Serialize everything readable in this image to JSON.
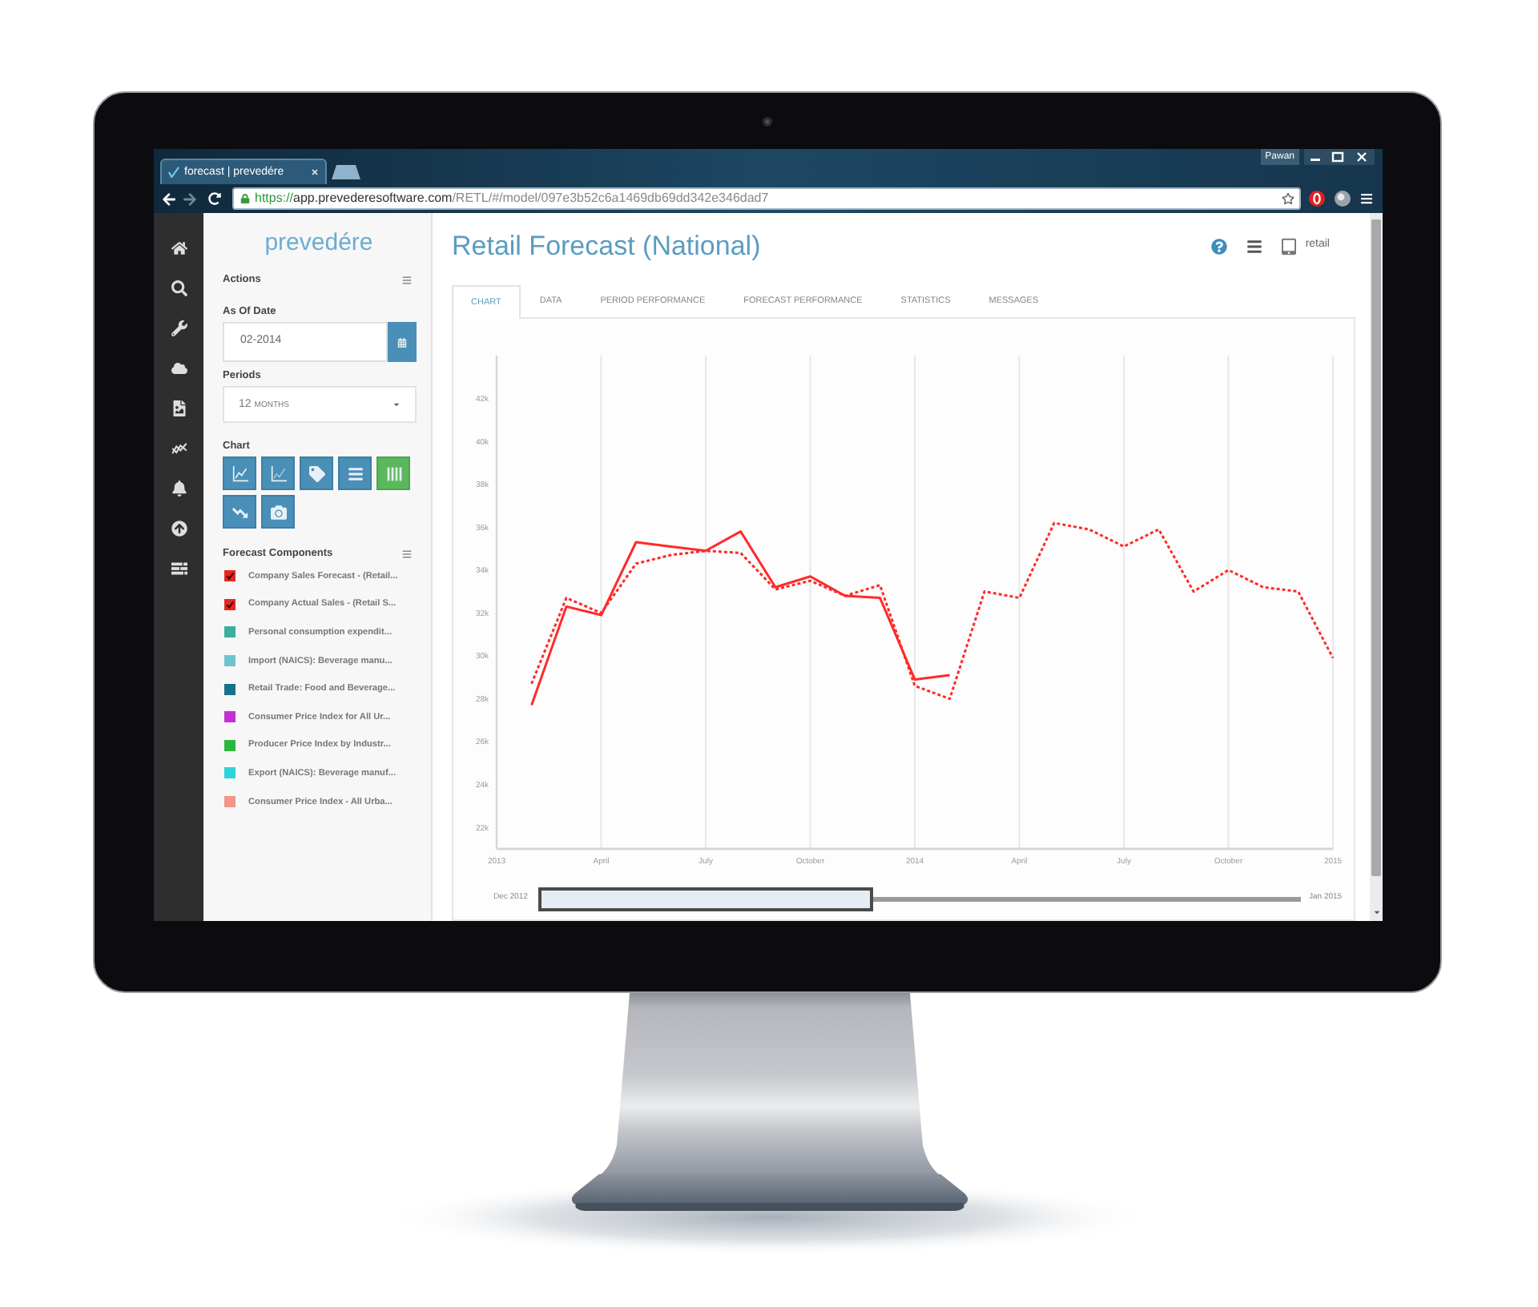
{
  "browser": {
    "tab": {
      "title": "forecast | prevedére"
    },
    "profile": "Pawan",
    "toolbar": {
      "back": {
        "disabled": false
      },
      "forward": {
        "disabled": true
      }
    },
    "address": {
      "scheme": "https://",
      "host": "app.prevederesoftware.com",
      "path": "/RETL/#/model/097e3b52c6a1469db69dd342e346dad7"
    }
  },
  "sidebar": {
    "logo": "prevedére",
    "actions": {
      "label": "Actions"
    },
    "as_of_date": {
      "label": "As Of Date",
      "value": "02-2014"
    },
    "periods": {
      "label": "Periods",
      "value": "12",
      "unit": "MONTHS"
    },
    "chart": {
      "label": "Chart",
      "buttons": [
        {
          "selected": false
        },
        {
          "selected": false
        },
        {
          "selected": false
        },
        {
          "selected": false
        },
        {
          "selected": true
        },
        {
          "selected": false
        },
        {
          "selected": false
        }
      ]
    },
    "components": {
      "label": "Forecast Components",
      "items": [
        {
          "label": "Company Sales Forecast - (Retail...",
          "color": "#e8251f",
          "checked": true
        },
        {
          "label": "Company Actual Sales - (Retail S...",
          "color": "#e8251f",
          "checked": true
        },
        {
          "label": "Personal consumption expendit...",
          "color": "#3bae9f",
          "checked": false
        },
        {
          "label": "Import (NAICS): Beverage manu...",
          "color": "#6cc6cb",
          "checked": false
        },
        {
          "label": "Retail Trade: Food and Beverage...",
          "color": "#16728a",
          "checked": false
        },
        {
          "label": "Consumer Price Index for All Ur...",
          "color": "#c42fd3",
          "checked": false
        },
        {
          "label": "Producer Price Index by Industr...",
          "color": "#2bb63e",
          "checked": false
        },
        {
          "label": "Export (NAICS): Beverage manuf...",
          "color": "#2ad4d8",
          "checked": false
        },
        {
          "label": "Consumer Price Index - All Urba...",
          "color": "#f3958a",
          "checked": false
        }
      ]
    }
  },
  "main": {
    "title": "Retail Forecast (National)",
    "account": "retail",
    "tabs": [
      {
        "label": "CHART",
        "selected": true
      },
      {
        "label": "DATA",
        "selected": false
      },
      {
        "label": "PERIOD PERFORMANCE",
        "selected": false
      },
      {
        "label": "FORECAST PERFORMANCE",
        "selected": false
      },
      {
        "label": "STATISTICS",
        "selected": false
      },
      {
        "label": "MESSAGES",
        "selected": false
      }
    ],
    "chart": {
      "chart_data": {
        "type": "line",
        "grid": true,
        "categories": [
          "2013",
          null,
          null,
          "April",
          null,
          null,
          "July",
          null,
          null,
          "October",
          null,
          null,
          "2014",
          null,
          null,
          "April",
          null,
          null,
          "July",
          null,
          null,
          "October",
          null,
          null,
          "2015"
        ],
        "ylim": [
          21000,
          44000
        ],
        "yticks": [
          {
            "value": 22000,
            "label": "22k"
          },
          {
            "value": 24000,
            "label": "24k"
          },
          {
            "value": 26000,
            "label": "26k"
          },
          {
            "value": 28000,
            "label": "28k"
          },
          {
            "value": 30000,
            "label": "30k"
          },
          {
            "value": 32000,
            "label": "32k"
          },
          {
            "value": 34000,
            "label": "34k"
          },
          {
            "value": 36000,
            "label": "36k"
          },
          {
            "value": 38000,
            "label": "38k"
          },
          {
            "value": 40000,
            "label": "40k"
          },
          {
            "value": 42000,
            "label": "42k"
          }
        ],
        "series": [
          {
            "color": "#ff2a2a",
            "line_style": "dotted",
            "values": [
              null,
              28700,
              32700,
              32000,
              34300,
              34700,
              34900,
              34800,
              33100,
              33500,
              32800,
              33300,
              28600,
              28000,
              33000,
              32700,
              36200,
              35900,
              35100,
              35900,
              33000,
              34000,
              33200,
              33000,
              29900
            ]
          },
          {
            "color": "#ff2a2a",
            "line_style": "solid",
            "values": [
              null,
              27700,
              32300,
              31900,
              35300,
              35100,
              34900,
              35800,
              33200,
              33700,
              32800,
              32700,
              28900,
              29100,
              null,
              null,
              null,
              null,
              null,
              null,
              null,
              null,
              null,
              null,
              null
            ]
          }
        ]
      },
      "navigator": {
        "start_label": "Dec 2012",
        "end_label": "Jan 2015",
        "level": 0.44
      }
    }
  }
}
